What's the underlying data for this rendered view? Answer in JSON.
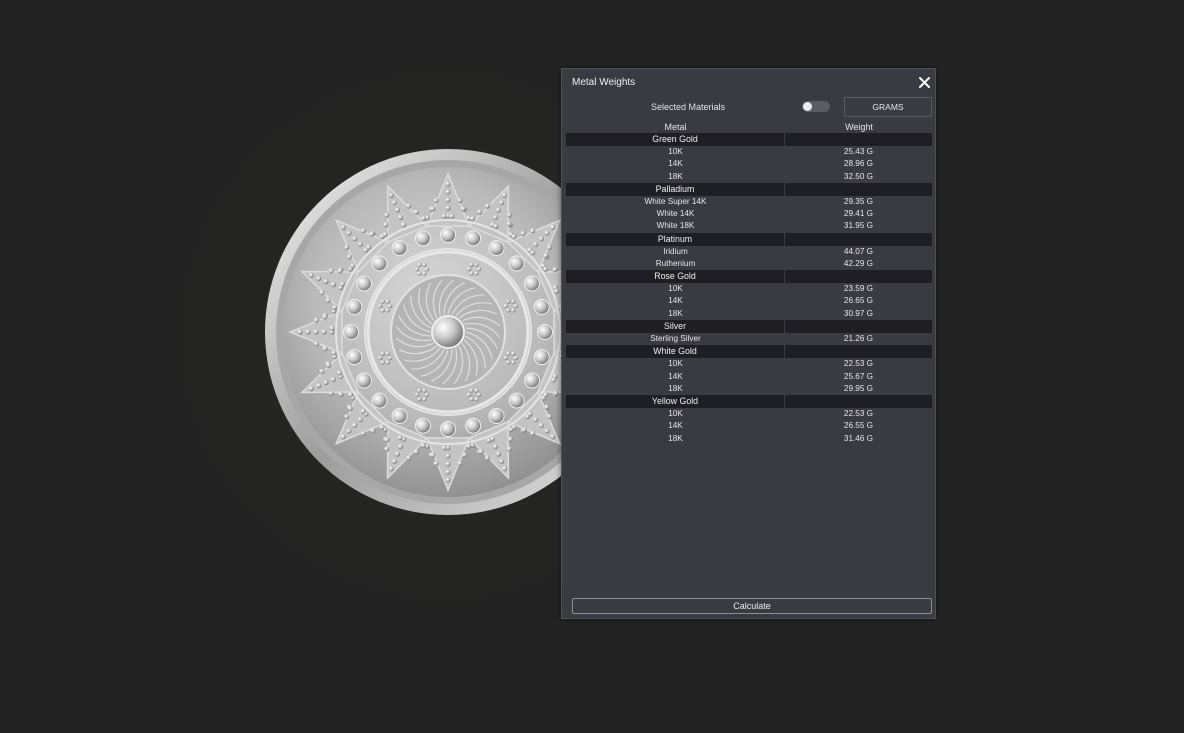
{
  "panel": {
    "title": "Metal Weights",
    "close_icon": "close-icon",
    "selected_materials_label": "Selected Materials",
    "toggle_state": "off",
    "units_button_label": "GRAMS",
    "col_metal": "Metal",
    "col_weight": "Weight",
    "calculate_label": "Calculate"
  },
  "groups": [
    {
      "name": "Green Gold",
      "items": [
        {
          "name": "10K",
          "weight": "25.43 G"
        },
        {
          "name": "14K",
          "weight": "28.96 G"
        },
        {
          "name": "18K",
          "weight": "32.50 G"
        }
      ]
    },
    {
      "name": "Palladium",
      "items": [
        {
          "name": "White Super 14K",
          "weight": "29.35 G"
        },
        {
          "name": "White 14K",
          "weight": "29.41 G"
        },
        {
          "name": "White 18K",
          "weight": "31.95 G"
        }
      ]
    },
    {
      "name": "Platinum",
      "items": [
        {
          "name": "Iridium",
          "weight": "44.07 G"
        },
        {
          "name": "Ruthenium",
          "weight": "42.29 G"
        }
      ]
    },
    {
      "name": "Rose Gold",
      "items": [
        {
          "name": "10K",
          "weight": "23.59 G"
        },
        {
          "name": "14K",
          "weight": "26.65 G"
        },
        {
          "name": "18K",
          "weight": "30.97 G"
        }
      ]
    },
    {
      "name": "Silver",
      "items": [
        {
          "name": "Sterling Silver",
          "weight": "21.26 G"
        }
      ]
    },
    {
      "name": "White Gold",
      "items": [
        {
          "name": "10K",
          "weight": "22.53 G"
        },
        {
          "name": "14K",
          "weight": "25.67 G"
        },
        {
          "name": "18K",
          "weight": "29.95 G"
        }
      ]
    },
    {
      "name": "Yellow Gold",
      "items": [
        {
          "name": "10K",
          "weight": "22.53 G"
        },
        {
          "name": "14K",
          "weight": "26.55 G"
        },
        {
          "name": "18K",
          "weight": "31.46 G"
        }
      ]
    }
  ],
  "colors": {
    "viewport_bg": "#232323",
    "panel_bg": "#3a3a41",
    "group_row_bg": "#1f1f23",
    "text": "#e6e6e9"
  }
}
